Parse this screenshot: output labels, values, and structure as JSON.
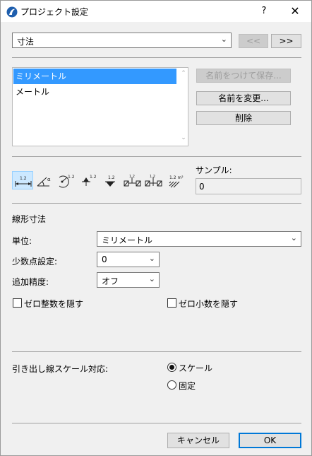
{
  "window": {
    "title": "プロジェクト設定",
    "help": "?",
    "close": "✕"
  },
  "top": {
    "category_value": "寸法",
    "prev_label": "<<",
    "next_label": ">>"
  },
  "presets": {
    "items": [
      "ミリメートル",
      "メートル"
    ],
    "selected_index": 0
  },
  "actions": {
    "save_as_label": "名前をつけて保存...",
    "rename_label": "名前を変更...",
    "delete_label": "削除"
  },
  "tools": {
    "icons": [
      "linear-dimension-icon",
      "angle-dimension-icon",
      "radial-dimension-icon",
      "level-dimension-icon",
      "elevation-dimension-icon",
      "door-window-dimension-icon",
      "sill-height-dimension-icon",
      "area-dimension-icon"
    ],
    "selected_index": 0
  },
  "sample": {
    "label": "サンプル:",
    "value": "0"
  },
  "linear": {
    "heading": "線形寸法",
    "unit_label": "単位:",
    "unit_value": "ミリメートル",
    "decimals_label": "少数点設定:",
    "decimals_value": "0",
    "extra_precision_label": "追加精度:",
    "extra_precision_value": "オフ",
    "hide_zero_int_label": "ゼロ整数を隠す",
    "hide_zero_dec_label": "ゼロ小数を隠す"
  },
  "leader": {
    "label": "引き出し線スケール対応:",
    "options": [
      "スケール",
      "固定"
    ],
    "selected_index": 0
  },
  "footer": {
    "cancel_label": "キャンセル",
    "ok_label": "OK"
  }
}
